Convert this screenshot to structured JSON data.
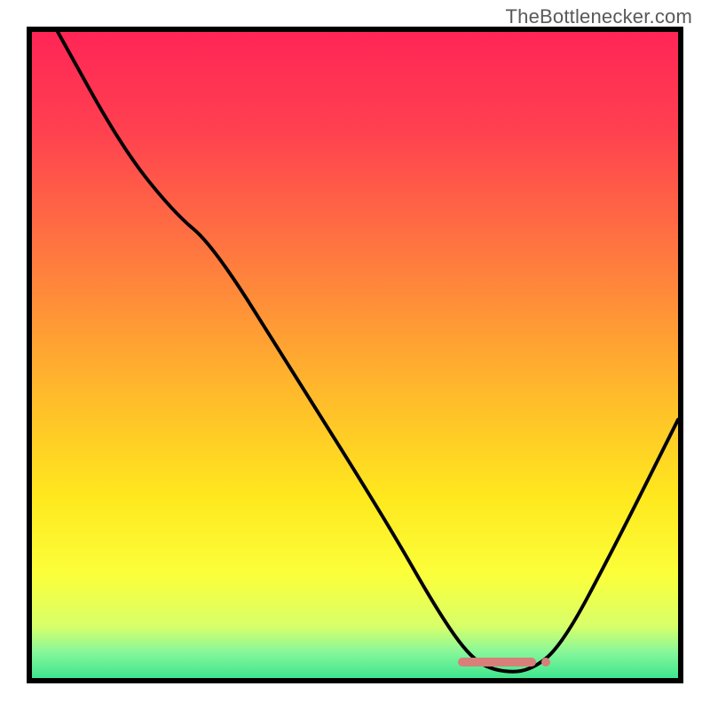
{
  "watermark": "TheBottlenecker.com",
  "chart_data": {
    "type": "line",
    "title": "",
    "xlabel": "",
    "ylabel": "",
    "xlim": [
      0,
      100
    ],
    "ylim": [
      0,
      100
    ],
    "gradient_stops": [
      {
        "pct": 0,
        "color": "#ff2556"
      },
      {
        "pct": 15,
        "color": "#ff4050"
      },
      {
        "pct": 35,
        "color": "#ff7a3f"
      },
      {
        "pct": 55,
        "color": "#ffb72c"
      },
      {
        "pct": 72,
        "color": "#ffe81e"
      },
      {
        "pct": 84,
        "color": "#fbff3a"
      },
      {
        "pct": 92,
        "color": "#d8ff6a"
      },
      {
        "pct": 96,
        "color": "#86f79a"
      },
      {
        "pct": 100,
        "color": "#3fe58f"
      }
    ],
    "curve_points": [
      {
        "x": 4,
        "y": 100
      },
      {
        "x": 14,
        "y": 82
      },
      {
        "x": 22,
        "y": 72
      },
      {
        "x": 28,
        "y": 67
      },
      {
        "x": 40,
        "y": 48
      },
      {
        "x": 55,
        "y": 24
      },
      {
        "x": 63,
        "y": 10
      },
      {
        "x": 68,
        "y": 3
      },
      {
        "x": 72,
        "y": 1
      },
      {
        "x": 77,
        "y": 1
      },
      {
        "x": 82,
        "y": 5
      },
      {
        "x": 90,
        "y": 20
      },
      {
        "x": 100,
        "y": 40
      }
    ],
    "marker": {
      "x_start_pct": 66,
      "x_end_pct": 78,
      "y_pct": 2.5,
      "color": "#d87f7a"
    }
  }
}
